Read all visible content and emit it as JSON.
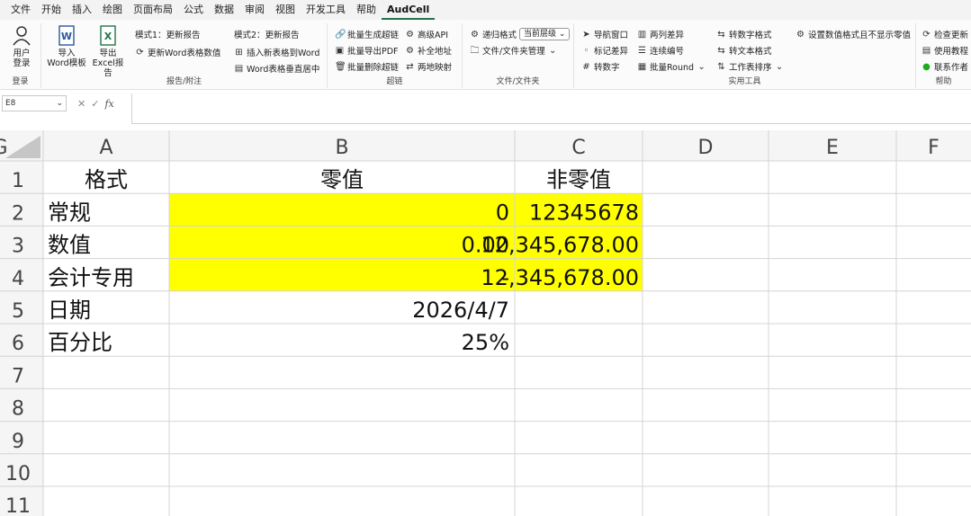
{
  "menu": {
    "tabs": [
      "文件",
      "开始",
      "插入",
      "绘图",
      "页面布局",
      "公式",
      "数据",
      "审阅",
      "视图",
      "开发工具",
      "帮助",
      "AudCell"
    ],
    "active_tab": "AudCell"
  },
  "ribbon": {
    "login": {
      "user_label_1": "用户",
      "user_label_2": "登录",
      "group": "登录"
    },
    "export": {
      "import_word_1": "导入",
      "import_word_2": "Word模板",
      "export_excel_1": "导出",
      "export_excel_2": "Excel报告",
      "mode1": "模式1：更新报告",
      "update_word": "更新Word表格数值",
      "mode2": "模式2：更新报告",
      "insert_word": "插入新表格到Word",
      "word_center": "Word表格垂直居中",
      "group": "报告/附注"
    },
    "index": {
      "batch_gen": "批量生成超链",
      "batch_pdf": "批量导出PDF",
      "batch_delete": "批量删除超链",
      "advanced_api": "高级API",
      "fill_address": "补全地址",
      "two_way": "两地映射",
      "group": "超链"
    },
    "files": {
      "filter_format": "递归格式",
      "current_level": "当前层级",
      "file_manage": "文件/文件夹管理",
      "group": "文件/文件夹"
    },
    "tools": {
      "nav_window": "导航窗口",
      "tag_compare": "标记差异",
      "number_convert": "转数字",
      "two_col_diff": "两列差异",
      "continuous_num": "连续编号",
      "batch_round": "批量Round",
      "to_number_format": "转数字格式",
      "to_text_format": "转文本格式",
      "worksheet_sort": "工作表排序",
      "group": "实用工具"
    },
    "setting": {
      "zero_display": "设置数值格式且不显示零值"
    },
    "help": {
      "check_update": "检查更新",
      "tutorial": "使用教程",
      "contact": "联系作者",
      "group": "帮助"
    }
  },
  "formula_bar": {
    "name_box": "E8",
    "cancel": "✕",
    "enter": "✓",
    "fx": "fx",
    "formula": ""
  },
  "sheet": {
    "columns": [
      "A",
      "B",
      "C",
      "D",
      "E",
      "F",
      "G"
    ],
    "rows": [
      "1",
      "2",
      "3",
      "4",
      "5",
      "6",
      "7",
      "8",
      "9",
      "10",
      "11"
    ],
    "cells": {
      "A1": "格式",
      "B1": "零值",
      "C1": "非零值",
      "A2": "常规",
      "B2": "0",
      "C2": "12345678",
      "A3": "数值",
      "B3": "0.00",
      "C3": "12,345,678.00",
      "A4": "会计专用",
      "B4": "-",
      "C4": "12,345,678.00",
      "A5": "日期",
      "B5": "2026/4/7",
      "A6": "百分比",
      "B6": "25%"
    },
    "highlight_color": "#ffff00"
  }
}
